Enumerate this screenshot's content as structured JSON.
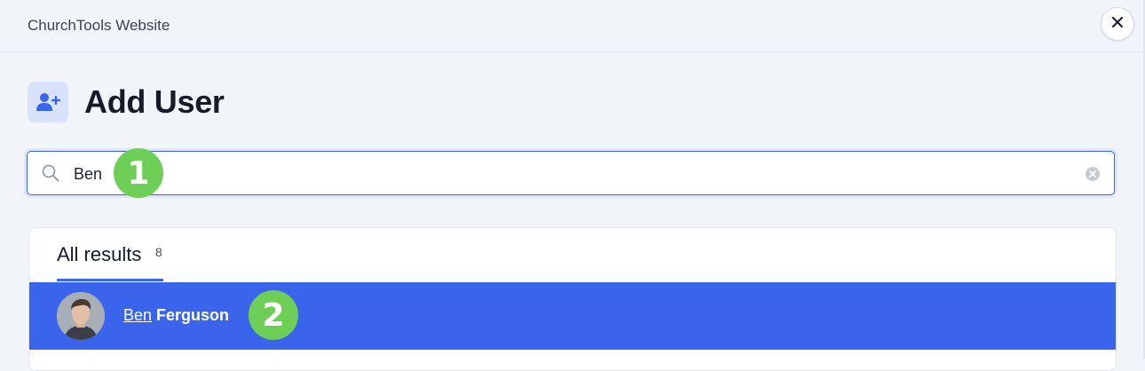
{
  "window": {
    "title": "ChurchTools Website",
    "close_icon": "close-icon"
  },
  "page": {
    "title": "Add User",
    "icon": "user-plus-icon"
  },
  "search": {
    "value": "Ben",
    "placeholder": "",
    "icon": "search-icon",
    "clear_icon": "clear-icon"
  },
  "annotations": {
    "badge_1": "1",
    "badge_2": "2"
  },
  "results": {
    "tabs": [
      {
        "label": "All results",
        "count": "8",
        "active": true
      }
    ],
    "items": [
      {
        "highlight": "Ben",
        "rest": " Ferguson",
        "selected": true
      }
    ]
  },
  "colors": {
    "accent": "#3b64ec",
    "badge": "#6ecf57",
    "background": "#f1f4f9"
  }
}
